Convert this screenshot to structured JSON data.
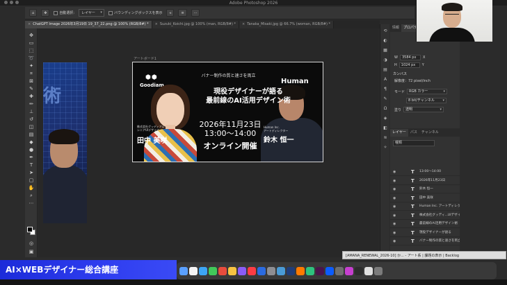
{
  "window": {
    "app_title": "Adobe Photoshop 2026"
  },
  "options_bar": {
    "auto_select_label": "自動選択:",
    "target_value": "レイヤー",
    "bbox_label": "バウンディングボックスを表示"
  },
  "tabs": [
    {
      "label": "ChatGPT Image 2026年3月19日 19_37_22.png @ 100% (RGB/8#) *",
      "active": true
    },
    {
      "label": "Suzuki_Koichi.jpg @ 100% (man, RGB/8#) *",
      "active": false
    },
    {
      "label": "Tanaka_Misaki.jpg @ 66.7% (woman, RGB/8#) *",
      "active": false
    }
  ],
  "artboard": {
    "label": "アートボード1",
    "tagline": "バナー制作の質と速さを両立",
    "headline_line1": "現役デザイナーが語る",
    "headline_line2": "最前線のAI活用デザイン術",
    "date": "2026年11月23日",
    "time": "13:00〜14:00",
    "mode": "オンライン開催",
    "brand_left": "Goodiam",
    "brand_right": "Human",
    "left_company": "株式会社グッディアム",
    "left_role": "シニアUIデザイナー",
    "left_name": "田中 美咲",
    "right_company": "Human Inc.",
    "right_role": "アートディレクター",
    "right_name": "鈴木 恒一"
  },
  "properties": {
    "tabs": [
      "情報",
      "プロパティ"
    ],
    "w_label": "W",
    "w_value": "3584 px",
    "h_label": "H",
    "h_value": "1024 px",
    "x_label": "X",
    "y_label": "Y",
    "section_label": "カンバス",
    "resolution": "解像度：72 pixel/inch",
    "mode_label": "モード",
    "mode_value": "RGB カラー",
    "depth_value": "8 bit/チャンネル",
    "fill_label": "塗り",
    "fill_value": "透明"
  },
  "layers": {
    "tabs": [
      "レイヤー",
      "パス",
      "チャンネル"
    ],
    "search_placeholder": "種類",
    "items": [
      "13:00〜14:00",
      "2026年11月23日",
      "鈴木 恒一",
      "田中 美咲",
      "Human Inc. アートディレクター",
      "株式会社グッディ...UIデザイナー",
      "最前線のAI活用デザイン術",
      "現役デザイナーが語る",
      "バナー制作の質と速さを両立"
    ]
  },
  "toast": {
    "text": "[AMANA_RENEWAL_2026-10] か... - アート系 | 課題の表示 | Backlog"
  },
  "course_banner": {
    "text": "AI×WEBデザイナー総合講座"
  },
  "colors": {
    "banner_blue": "#2f3ef0",
    "panel_bg": "#323232",
    "canvas_bg": "#282828"
  }
}
